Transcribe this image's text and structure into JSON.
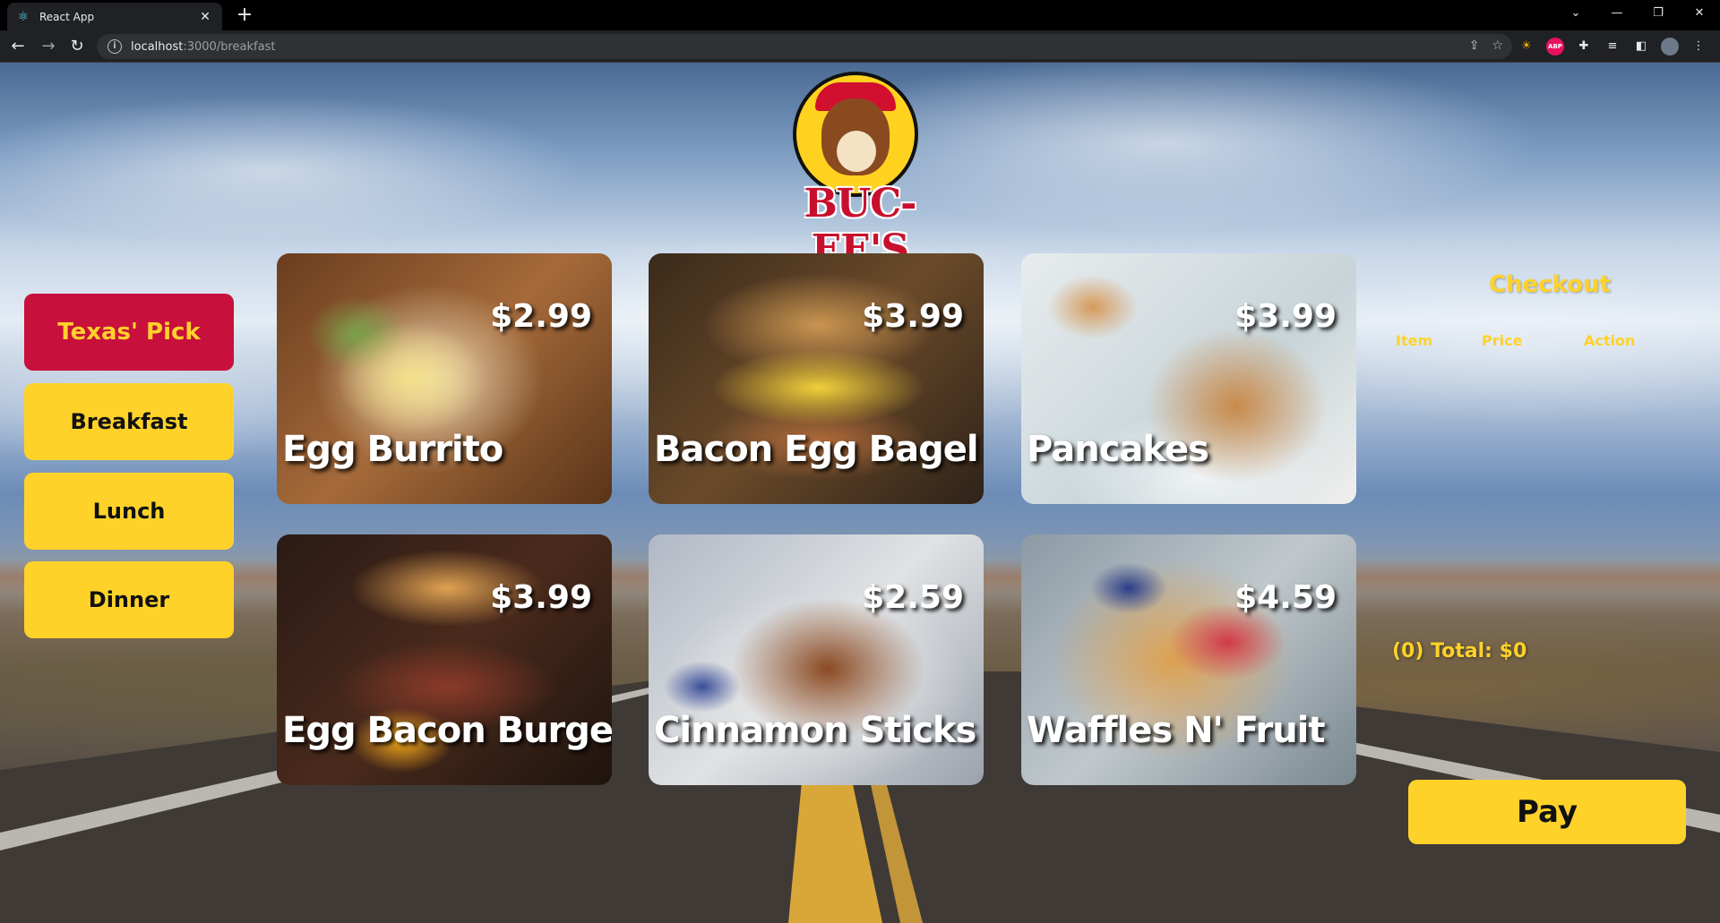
{
  "browser": {
    "tab_title": "React App",
    "url_host": "localhost",
    "url_path": ":3000/breakfast"
  },
  "colors": {
    "accent_yellow": "#ffd22a",
    "accent_red": "#c8103c"
  },
  "logo": {
    "text": "BUC-EE'S"
  },
  "categories": [
    {
      "label": "Texas' Pick",
      "active": true
    },
    {
      "label": "Breakfast",
      "active": false
    },
    {
      "label": "Lunch",
      "active": false
    },
    {
      "label": "Dinner",
      "active": false
    }
  ],
  "menu": [
    {
      "name": "Egg Burrito",
      "price": "$2.99"
    },
    {
      "name": "Bacon Egg Bagel",
      "price": "$3.99"
    },
    {
      "name": "Pancakes",
      "price": "$3.99"
    },
    {
      "name": "Egg Bacon Burger",
      "price": "$3.99"
    },
    {
      "name": "Cinnamon Sticks",
      "price": "$2.59"
    },
    {
      "name": "Waffles N' Fruit",
      "price": "$4.59"
    }
  ],
  "checkout": {
    "title": "Checkout",
    "columns": [
      "Item",
      "Price",
      "Action"
    ],
    "total_label": "(0) Total: $0",
    "pay_label": "Pay"
  }
}
